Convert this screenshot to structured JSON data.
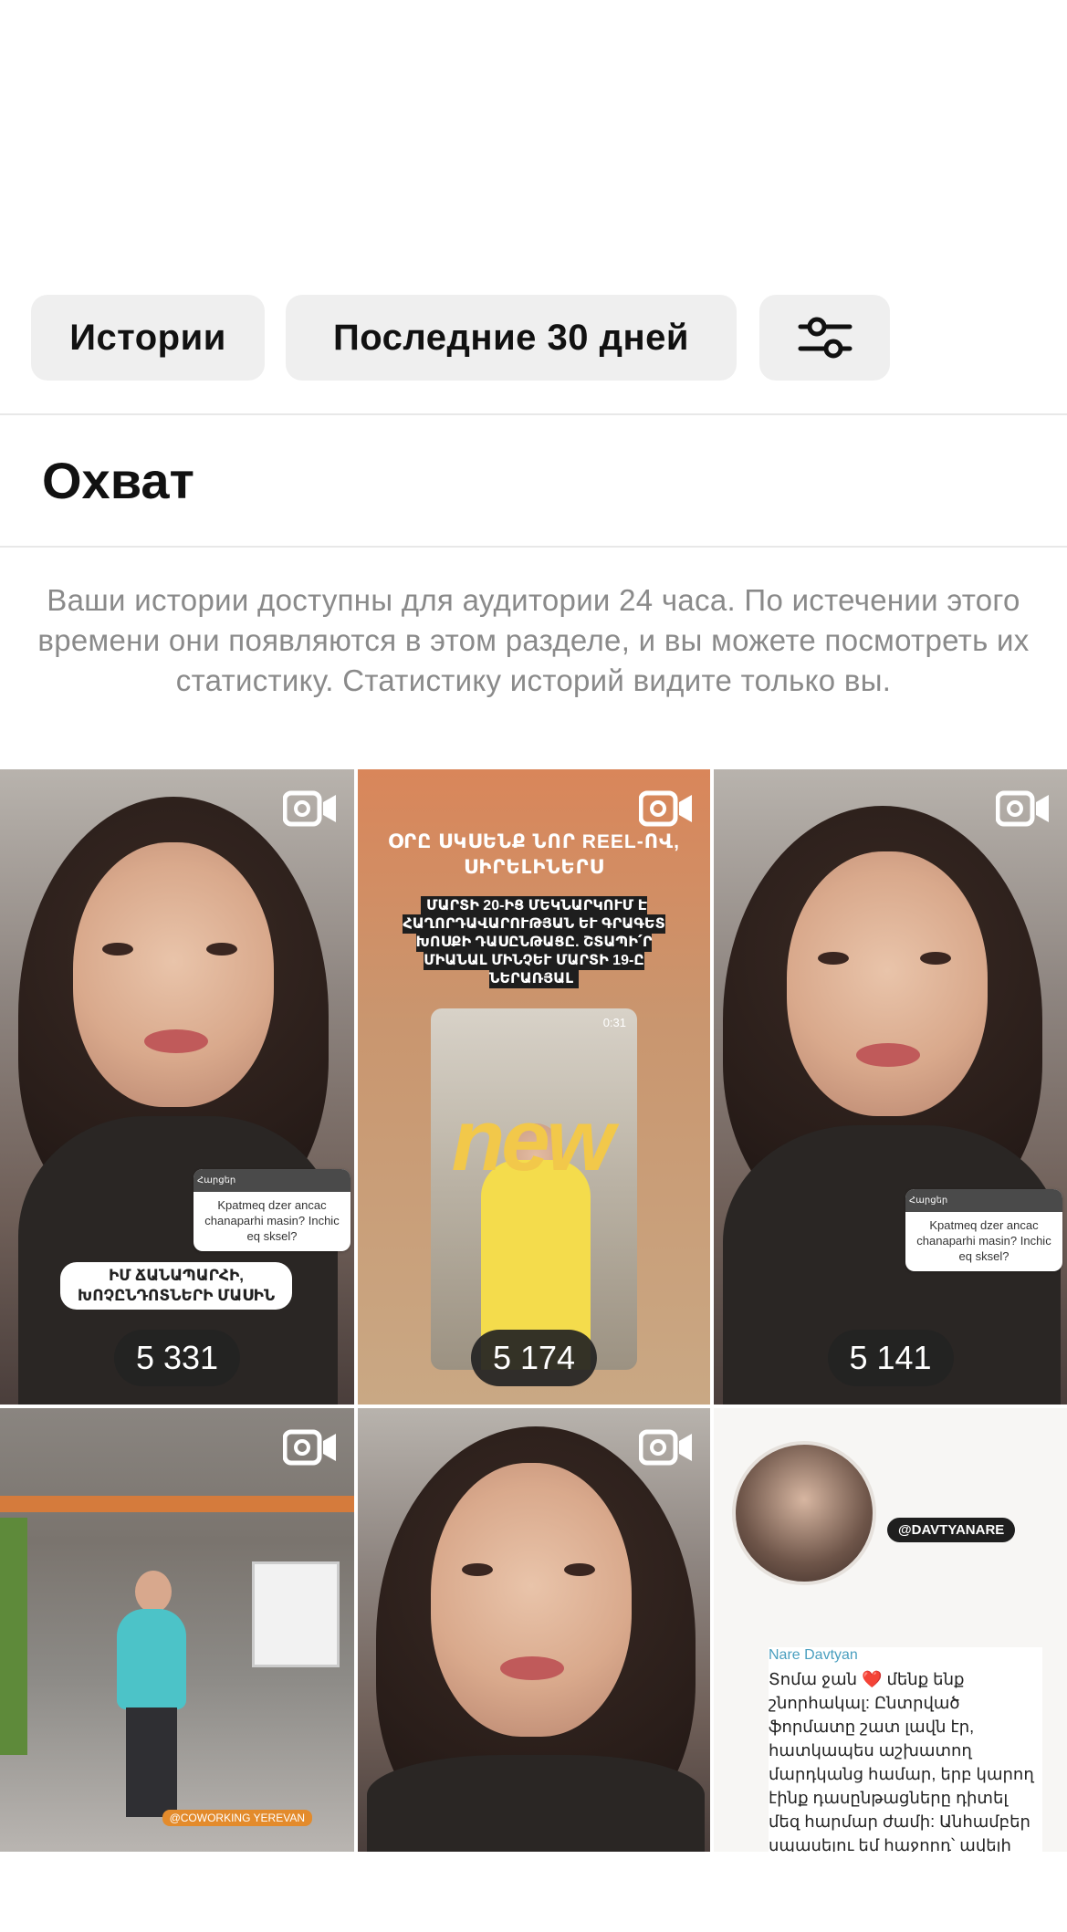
{
  "filters": {
    "type_label": "Истории",
    "period_label": "Последние 30 дней",
    "settings_icon": "sliders-icon"
  },
  "section": {
    "title": "Охват",
    "note": "Ваши истории доступны для аудитории 24 часа. По истечении этого времени они появляются в этом разделе, и вы можете посмотреть их статистику. Статистику историй видите только вы."
  },
  "stories": [
    {
      "count": "5 331",
      "media_icon": "video-camera-icon",
      "caption": "ԻՄ ՃԱՆԱՊԱՐՀԻ, ԽՈՉԸՆԴՈՏՆԵՐԻ ՄԱՍԻՆ",
      "question": "Kpatmeq dzer ancac chanaparhi masin? Inchic eq sksel?"
    },
    {
      "count": "5 174",
      "media_icon": "video-camera-icon",
      "title": "ՕՐԸ ՍԿՍԵՆՔ ՆՈՐ REEL-ՈՎ, ՍԻՐԵԼԻՆԵՐՍ",
      "subtitle": "ՄԱՐՏԻ 20-ԻՑ ՄԵԿՆԱՐԿՈՒՄ Է ՀԱՂՈՐԴԱՎԱՐՈՒԹՅԱՆ ԵՒ ԳՐԱԳԵՏ ԽՈՍՔԻ ԴԱՍԸՆԹԱՑԸ. ՇՏԱՊԻ՛Ր ՄԻԱՆԱԼ ՄԻՆՉԵՒ ՄԱՐՏԻ 19-Ը ՆԵՐԱՌՅԱԼ",
      "timer": "0:31",
      "overlay": "new"
    },
    {
      "count": "5 141",
      "media_icon": "video-camera-icon",
      "question": "Kpatmeq dzer ancac chanaparhi masin? Inchic eq sksel?"
    },
    {
      "count": "",
      "media_icon": "video-camera-icon",
      "tag": "@COWORKING YEREVAN"
    },
    {
      "count": "",
      "media_icon": "video-camera-icon"
    },
    {
      "count": "",
      "handle": "@DAVTYANARE",
      "author": "Nare Davtyan",
      "text": "Տոմա ջան ❤️ մենք ենք շնորհակալ: Ընտրված ֆորմատը շատ լավն էր, հատկապես աշխատող մարդկանց համար, երբ կարող էինք դասընթացները դիտել մեզ հարմար ժամի: Անհամբեր սպասելու եմ հաջորդ՝ ավելի պրակտիկ դասընթացներին: Սա շատ լավ մեկնարկ էր ինձ համար, բավականին ոգևորվել եմ:"
    }
  ]
}
